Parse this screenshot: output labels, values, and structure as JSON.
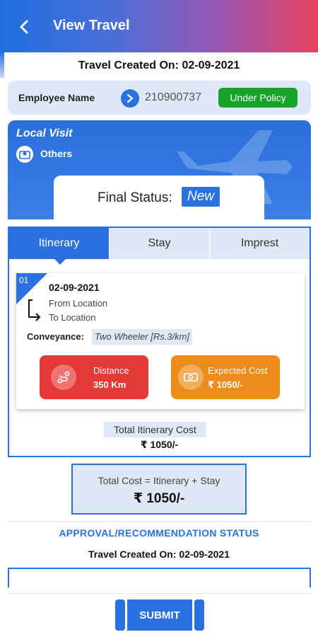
{
  "header": {
    "title": "View Travel",
    "back_icon": "chevron-left-icon",
    "gradient_colors": [
      "#1f6fe0",
      "#e9415e"
    ]
  },
  "travel": {
    "created_on": "Travel Created On: 02-09-2021"
  },
  "employee": {
    "label": "Employee Name",
    "id": "210900737",
    "policy_status": "Under Policy",
    "policy_color": "#17a327"
  },
  "visit": {
    "type": "Local Visit",
    "category": "Others",
    "final_status_label": "Final Status:",
    "final_status_value": "New"
  },
  "tabs": [
    {
      "label": "Itinerary",
      "active": true
    },
    {
      "label": "Stay",
      "active": false
    },
    {
      "label": "Imprest",
      "active": false
    }
  ],
  "itinerary": {
    "sequence": "01",
    "date": "02-09-2021",
    "from": "From Location",
    "to": "To Location",
    "conveyance_label": "Conveyance:",
    "conveyance_value": "Two Wheeler [Rs.3/km]",
    "distance": {
      "label": "Distance",
      "value": "350 Km",
      "icon": "route-icon",
      "color": "#e53935"
    },
    "expected_cost": {
      "label": "Expected Cost",
      "value": "₹ 1050/-",
      "icon": "cash-icon",
      "color": "#ec8c1a"
    },
    "total_label": "Total Itinerary Cost",
    "total_value": "₹ 1050/-"
  },
  "total_cost": {
    "formula": "Total Cost = Itinerary + Stay",
    "amount": "₹ 1050/-"
  },
  "approval": {
    "title": "APPROVAL/RECOMMENDATION STATUS",
    "created_on": "Travel Created On: 02-09-2021"
  },
  "actions": {
    "submit_label": "SUBMIT"
  },
  "accent_color": "#2b72e0"
}
